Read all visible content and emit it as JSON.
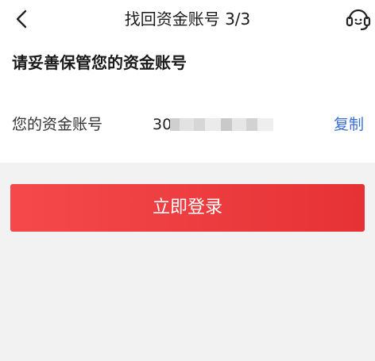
{
  "nav": {
    "title": "找回资金账号 3/3",
    "back_icon": "chevron-left-icon",
    "service_icon": "customer-service-icon"
  },
  "card": {
    "heading": "请妥善保管您的资金账号",
    "account_label": "您的资金账号",
    "account_value_visible": "30",
    "copy_label": "复制"
  },
  "actions": {
    "login_label": "立即登录"
  },
  "colors": {
    "accent": "#e63235",
    "link": "#3b6fd4",
    "background": "#f2f2f2"
  }
}
